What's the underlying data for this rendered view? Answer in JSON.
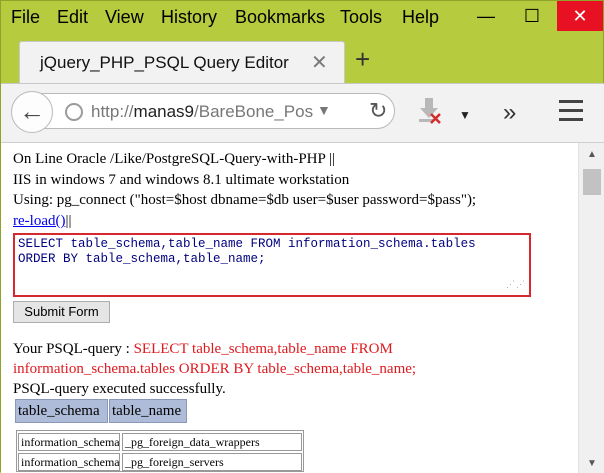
{
  "menu": {
    "items": [
      "File",
      "Edit",
      "View",
      "History",
      "Bookmarks",
      "Tools",
      "Help"
    ]
  },
  "window": {
    "minimize": "—",
    "maximize": "☐",
    "close": "✕"
  },
  "tab": {
    "title": "jQuery_PHP_PSQL Query Editor",
    "close": "✕",
    "new_tab": "+"
  },
  "nav": {
    "url_prefix": "http://",
    "url_host": "manas9",
    "url_rest": "/BareBone_Postg"
  },
  "page": {
    "line1": "On Line Oracle /Like/PostgreSQL-Query-with-PHP ||",
    "line2": "IIS in windows 7 and windows 8.1 ultimate workstation",
    "line3": "Using: pg_connect (\"host=$host dbname=$db user=$user password=$pass\");",
    "reload_link": "re-load()",
    "reload_suffix": "||",
    "query_text": "SELECT table_schema,table_name FROM information_schema.tables\nORDER BY table_schema,table_name;",
    "submit_label": "Submit Form",
    "psql_label": "Your PSQL-query : ",
    "psql_query_1": "SELECT table_schema,table_name FROM",
    "psql_query_2": "information_schema.tables ORDER BY table_schema,table_name;",
    "status": "PSQL-query executed successfully."
  },
  "results": {
    "headers": [
      "table_schema",
      "table_name"
    ],
    "rows": [
      [
        "information_schema",
        "_pg_foreign_data_wrappers"
      ],
      [
        "information_schema",
        "_pg_foreign_servers"
      ]
    ]
  }
}
